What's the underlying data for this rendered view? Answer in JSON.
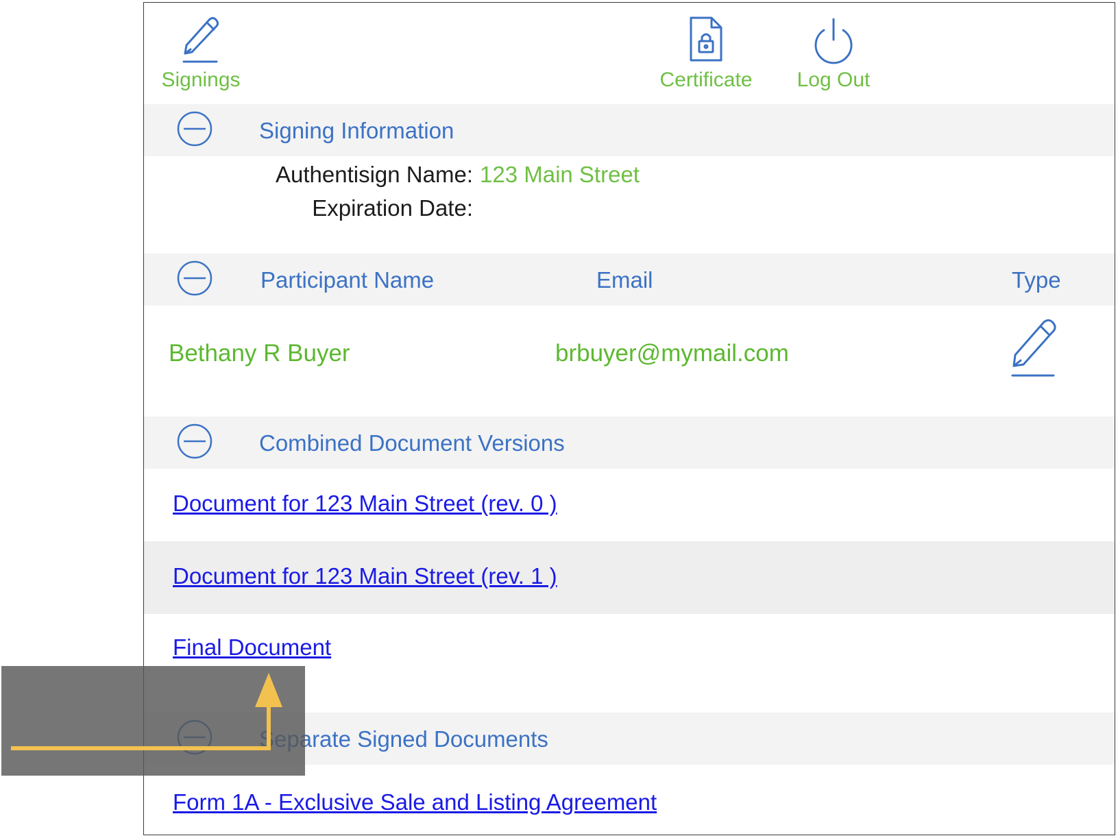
{
  "nav": {
    "signings": "Signings",
    "certificate": "Certificate",
    "logout": "Log Out"
  },
  "signing_info": {
    "header": "Signing Information",
    "name_label": "Authentisign Name:",
    "name_value": "123 Main Street",
    "expiration_label": "Expiration Date:",
    "expiration_value": ""
  },
  "participants": {
    "col_name": "Participant Name",
    "col_email": "Email",
    "col_type": "Type",
    "rows": [
      {
        "name": "Bethany R Buyer",
        "email": "brbuyer@mymail.com",
        "type_icon": "pen-icon"
      }
    ]
  },
  "combined_docs": {
    "header": "Combined Document Versions",
    "items": [
      "Document for 123 Main Street (rev. 0 )",
      "Document for 123 Main Street (rev. 1 )",
      "Final Document"
    ]
  },
  "separate_docs": {
    "header": "Separate Signed Documents",
    "items": [
      "Form 1A - Exclusive Sale and Listing Agreement"
    ]
  },
  "colors": {
    "accent_blue": "#3b72c4",
    "accent_green": "#6fbf44",
    "link_blue": "#1a1ae6",
    "arrow_yellow": "#f2c150"
  }
}
